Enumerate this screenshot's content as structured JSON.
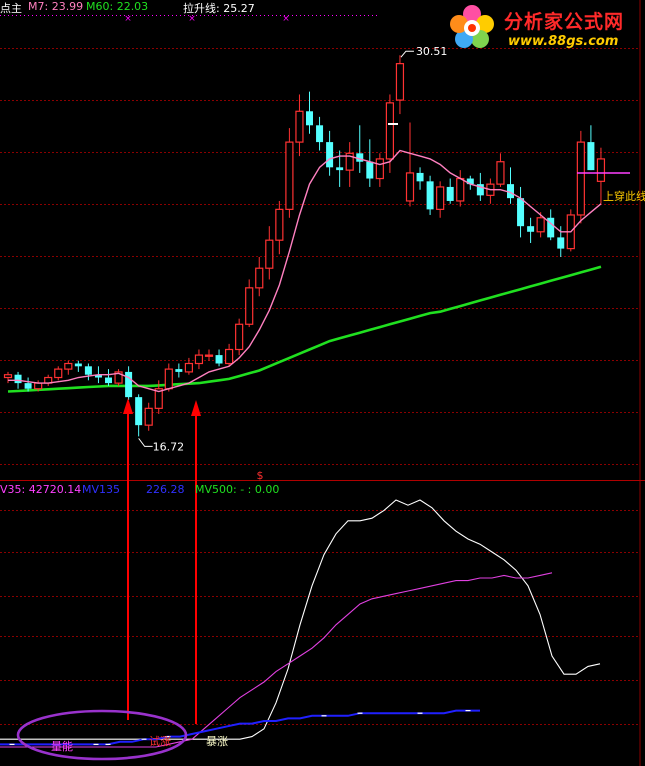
{
  "header_top": {
    "title_fragment": "点主",
    "ma7": "M7: 23.99",
    "ma60": "M60: 22.03",
    "pull_label": "拉升线: 25.27"
  },
  "header_bottom": {
    "v35": "V35: 42720.14",
    "mv135": "MV135",
    "mv135_value": "226.28",
    "mv500": "MV500: - : 0.00"
  },
  "logo": {
    "title": "分析家公式网",
    "url": "www.88gs.com"
  },
  "annotations": {
    "high_price": "30.51",
    "low_price": "16.72",
    "cross_label": "上穿此线",
    "dollar_mark": "$",
    "label_1": "量能",
    "label_2": "试涨",
    "label_3": "暴涨"
  },
  "colors": {
    "up": "#ff3232",
    "down": "#54ffff",
    "ma7": "#ff80c0",
    "ma60": "#20e020",
    "v35": "#ffffff",
    "mv135": "#e040e0",
    "mv500": "#2020ff",
    "grid": "#8b0000",
    "ellipse": "#9932cc",
    "arrow": "#ff0000"
  },
  "chart_data": [
    {
      "type": "candlestick",
      "title": "",
      "ylim": [
        15.8,
        31.5
      ],
      "high_label": 30.51,
      "low_label": 16.72,
      "candles": [
        [
          19.1,
          19.3,
          18.9,
          19.2
        ],
        [
          19.2,
          19.3,
          18.7,
          18.9
        ],
        [
          18.9,
          19.1,
          18.6,
          18.7
        ],
        [
          18.7,
          19.0,
          18.6,
          18.9
        ],
        [
          18.9,
          19.2,
          18.8,
          19.1
        ],
        [
          19.1,
          19.5,
          19.0,
          19.4
        ],
        [
          19.4,
          19.7,
          19.2,
          19.6
        ],
        [
          19.6,
          19.7,
          19.3,
          19.5
        ],
        [
          19.5,
          19.6,
          19.0,
          19.2
        ],
        [
          19.2,
          19.5,
          18.9,
          19.1
        ],
        [
          19.1,
          19.4,
          18.8,
          18.9
        ],
        [
          18.9,
          19.4,
          18.8,
          19.3
        ],
        [
          19.3,
          19.5,
          18.3,
          18.4
        ],
        [
          18.4,
          18.5,
          17.0,
          17.4
        ],
        [
          17.4,
          18.2,
          17.2,
          18.0
        ],
        [
          18.0,
          19.0,
          17.8,
          18.7
        ],
        [
          18.7,
          19.6,
          18.6,
          19.4
        ],
        [
          19.4,
          19.6,
          19.1,
          19.3
        ],
        [
          19.3,
          19.8,
          19.2,
          19.6
        ],
        [
          19.6,
          20.1,
          19.4,
          19.9
        ],
        [
          19.9,
          20.1,
          19.7,
          19.9
        ],
        [
          19.9,
          20.1,
          19.5,
          19.6
        ],
        [
          19.6,
          20.3,
          19.5,
          20.1
        ],
        [
          20.1,
          21.2,
          19.9,
          21.0
        ],
        [
          21.0,
          22.6,
          20.9,
          22.3
        ],
        [
          22.3,
          23.4,
          22.0,
          23.0
        ],
        [
          23.0,
          24.5,
          22.6,
          24.0
        ],
        [
          24.0,
          25.4,
          23.5,
          25.1
        ],
        [
          25.1,
          28.0,
          24.8,
          27.5
        ],
        [
          27.5,
          29.2,
          27.0,
          28.6
        ],
        [
          28.6,
          29.3,
          27.8,
          28.1
        ],
        [
          28.1,
          28.4,
          27.2,
          27.5
        ],
        [
          27.5,
          27.9,
          26.3,
          26.6
        ],
        [
          26.6,
          27.2,
          25.9,
          26.5
        ],
        [
          26.5,
          27.5,
          25.9,
          27.1
        ],
        [
          27.1,
          28.1,
          26.4,
          26.8
        ],
        [
          26.8,
          27.6,
          25.9,
          26.2
        ],
        [
          26.2,
          27.1,
          25.9,
          26.9
        ],
        [
          26.9,
          29.2,
          26.4,
          28.9
        ],
        [
          29.0,
          30.6,
          28.5,
          30.3
        ],
        [
          25.4,
          28.2,
          25.2,
          26.4
        ],
        [
          26.4,
          26.6,
          25.8,
          26.1
        ],
        [
          26.1,
          26.3,
          24.9,
          25.1
        ],
        [
          25.1,
          26.1,
          24.8,
          25.9
        ],
        [
          25.9,
          26.2,
          25.3,
          25.4
        ],
        [
          25.4,
          26.5,
          25.2,
          26.2
        ],
        [
          26.2,
          26.3,
          25.8,
          26.0
        ],
        [
          26.0,
          26.4,
          25.4,
          25.6
        ],
        [
          25.6,
          26.2,
          25.3,
          26.0
        ],
        [
          26.0,
          27.1,
          25.9,
          26.8
        ],
        [
          26.0,
          26.6,
          25.3,
          25.5
        ],
        [
          25.5,
          25.9,
          24.1,
          24.5
        ],
        [
          24.5,
          24.8,
          23.9,
          24.3
        ],
        [
          24.3,
          25.0,
          24.1,
          24.8
        ],
        [
          24.8,
          25.1,
          24.0,
          24.1
        ],
        [
          24.1,
          24.5,
          23.4,
          23.7
        ],
        [
          23.7,
          25.1,
          23.6,
          24.9
        ],
        [
          24.9,
          27.9,
          24.6,
          27.5
        ],
        [
          27.5,
          28.1,
          26.5,
          26.5
        ],
        [
          26.1,
          27.3,
          25.3,
          26.9
        ]
      ],
      "series": [
        {
          "name": "M7",
          "values": [
            19.0,
            19.0,
            18.95,
            18.9,
            18.9,
            18.95,
            19.0,
            19.1,
            19.15,
            19.2,
            19.2,
            19.25,
            19.1,
            18.8,
            18.7,
            18.6,
            18.7,
            18.8,
            18.9,
            19.1,
            19.3,
            19.4,
            19.5,
            19.8,
            20.2,
            20.8,
            21.5,
            22.4,
            23.6,
            24.9,
            26.0,
            26.6,
            26.9,
            27.0,
            27.0,
            26.9,
            26.8,
            26.7,
            26.8,
            27.2,
            27.1,
            27.0,
            26.9,
            26.7,
            26.4,
            26.2,
            26.0,
            25.9,
            25.8,
            25.8,
            25.7,
            25.5,
            25.2,
            24.9,
            24.6,
            24.3,
            24.3,
            24.7,
            25.0,
            25.3
          ]
        },
        {
          "name": "M60",
          "values": [
            18.6,
            18.62,
            18.64,
            18.66,
            18.68,
            18.7,
            18.72,
            18.74,
            18.76,
            18.78,
            18.8,
            18.8,
            18.8,
            18.8,
            18.8,
            18.82,
            18.84,
            18.86,
            18.88,
            18.9,
            18.95,
            19.0,
            19.05,
            19.15,
            19.25,
            19.35,
            19.5,
            19.65,
            19.8,
            19.95,
            20.1,
            20.25,
            20.4,
            20.5,
            20.6,
            20.7,
            20.8,
            20.9,
            21.0,
            21.1,
            21.2,
            21.3,
            21.4,
            21.45,
            21.55,
            21.65,
            21.75,
            21.85,
            21.95,
            22.05,
            22.15,
            22.25,
            22.35,
            22.45,
            22.55,
            22.65,
            22.75,
            22.85,
            22.95,
            23.05
          ]
        }
      ]
    },
    {
      "type": "line",
      "title": "",
      "ylim": [
        0,
        100
      ],
      "series": [
        {
          "name": "V35",
          "values": [
            8,
            8,
            8,
            8,
            8,
            8,
            8,
            8,
            8,
            8,
            8,
            8,
            8,
            8,
            8,
            8,
            8,
            8,
            8,
            8,
            8,
            9,
            12,
            22,
            35,
            52,
            67,
            79,
            87,
            92,
            92,
            93,
            96,
            100,
            98,
            100,
            97,
            92,
            88,
            85,
            83,
            80,
            77,
            73,
            67,
            56,
            40,
            33,
            33,
            36,
            37
          ]
        },
        {
          "name": "MV135",
          "values": [
            5,
            5,
            5,
            5,
            5,
            5,
            5,
            5,
            5,
            5,
            5,
            5,
            5,
            5,
            6,
            7,
            8,
            12,
            16,
            20,
            24,
            27,
            30,
            34,
            37,
            40,
            43,
            47,
            52,
            56,
            60,
            62,
            63,
            64,
            65,
            66,
            67,
            68,
            69,
            69,
            70,
            70,
            71,
            70,
            70,
            71,
            72
          ]
        },
        {
          "name": "MV500",
          "values": [
            6,
            6,
            6,
            6,
            6,
            6,
            6,
            6,
            6,
            6,
            7,
            7,
            8,
            8,
            9,
            9,
            10,
            11,
            12,
            13,
            14,
            14,
            15,
            15,
            16,
            16,
            17,
            17,
            17,
            17,
            18,
            18,
            18,
            18,
            18,
            18,
            18,
            18,
            19,
            19,
            19
          ]
        }
      ]
    }
  ]
}
